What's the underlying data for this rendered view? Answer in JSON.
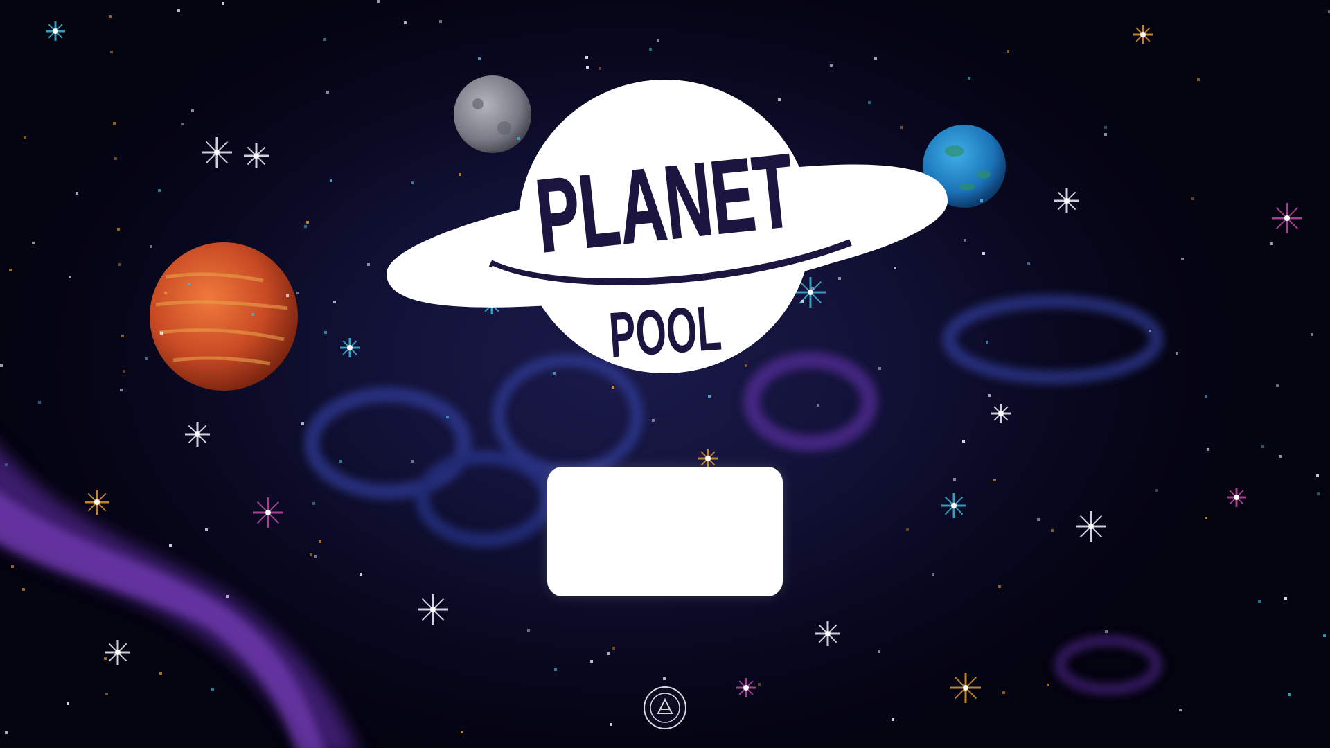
{
  "logo": {
    "line1": "PLANET",
    "line2": "POOL"
  },
  "start_button": {
    "label": ""
  },
  "seal": {
    "name": "university-seal-icon"
  },
  "colors": {
    "logo_fill": "#ffffff",
    "logo_ink": "#1b1540",
    "space_bg": "#0b0a26",
    "nebula_purple": "#5a2a9e",
    "nebula_blue": "#2f3fa8",
    "star_white": "#f2f2ff",
    "star_orange": "#e09a2a",
    "star_cyan": "#3fb7d8",
    "star_pink": "#c04aa8"
  }
}
